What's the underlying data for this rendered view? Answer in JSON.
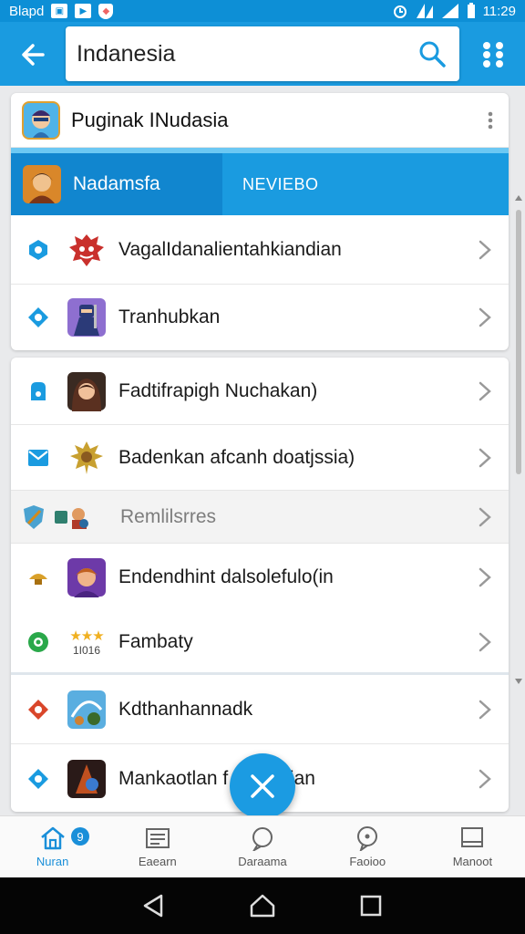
{
  "status_bar": {
    "carrier": "Blapd",
    "time": "11:29"
  },
  "app_bar": {
    "search_value": "Indanesia",
    "icons": [
      "back-arrow-icon",
      "search-icon",
      "grid-menu-icon"
    ]
  },
  "card1": {
    "header_title": "Puginak INudasia",
    "tabs": [
      {
        "label": "Nadamsfa",
        "active": true
      },
      {
        "label": "NEVIEBO",
        "active": false
      }
    ],
    "items": [
      {
        "label": "VagalIdanalientahkiandian"
      },
      {
        "label": "Tranhubkan"
      }
    ]
  },
  "card2": {
    "items": [
      {
        "label": "Fadtifrapigh Nuchakan)"
      },
      {
        "label": "Badenkan afcanh doatjssia)"
      },
      {
        "label": "Remlilsrres",
        "dimmed": true
      },
      {
        "label": "Endendhint dalsolefulo(in"
      },
      {
        "label": "Fambaty",
        "rating_text": "1I016"
      },
      {
        "label": "Kdthanhannadk"
      },
      {
        "label": "Mankaotlan f        maticaian"
      }
    ]
  },
  "bottom_nav": {
    "items": [
      {
        "label": "Nuran",
        "icon": "home-icon",
        "active": true
      },
      {
        "label": "Eaearn",
        "icon": "news-icon",
        "active": false
      },
      {
        "label": "Daraama",
        "icon": "chat-icon",
        "active": false
      },
      {
        "label": "Faoioo",
        "icon": "chat-bubble-icon",
        "active": false
      },
      {
        "label": "Manoot",
        "icon": "window-icon",
        "active": false
      }
    ],
    "badge_text": "9"
  },
  "colors": {
    "primary": "#1a9be0",
    "primary_dark": "#1186cf",
    "status": "#0d8fd6",
    "accent_light": "#6cc8f3"
  }
}
